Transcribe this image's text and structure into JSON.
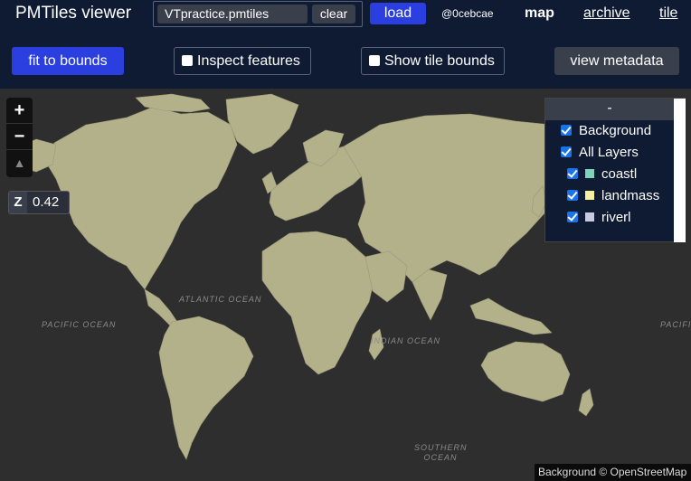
{
  "app": {
    "title": "PMTiles viewer"
  },
  "file": {
    "name": "VTpractice.pmtiles",
    "clear_label": "clear"
  },
  "header": {
    "load_label": "load",
    "hash": "@0cebcae"
  },
  "nav": {
    "map": "map",
    "archive": "archive",
    "tile": "tile"
  },
  "toolbar": {
    "fit_label": "fit to bounds",
    "inspect_label": "Inspect features",
    "inspect_checked": false,
    "tile_bounds_label": "Show tile bounds",
    "tile_bounds_checked": false,
    "metadata_label": "view metadata"
  },
  "map": {
    "zoom_in": "+",
    "zoom_out": "−",
    "compass": "▲",
    "zoom_prefix": "Z",
    "zoom_value": "0.42",
    "land_color": "#b3b18a",
    "water_color": "#2e2e2e",
    "oceans": {
      "atlantic": "ATLANTIC OCEAN",
      "pacific_left": "PACIFIC OCEAN",
      "pacific_right": "PACIFIC",
      "indian": "INDIAN OCEAN",
      "southern_1": "SOUTHERN",
      "southern_2": "OCEAN"
    },
    "attribution": "Background © OpenStreetMap"
  },
  "layers": {
    "collapse_label": "-",
    "items": [
      {
        "label": "Background",
        "checked": true
      },
      {
        "label": "All Layers",
        "checked": true
      },
      {
        "label": "coastl",
        "checked": true,
        "color": "#7fd1b9"
      },
      {
        "label": "landmass",
        "checked": true,
        "color": "#f5f0a0"
      },
      {
        "label": "riverl",
        "checked": true,
        "color": "#c8c8e0"
      }
    ]
  }
}
